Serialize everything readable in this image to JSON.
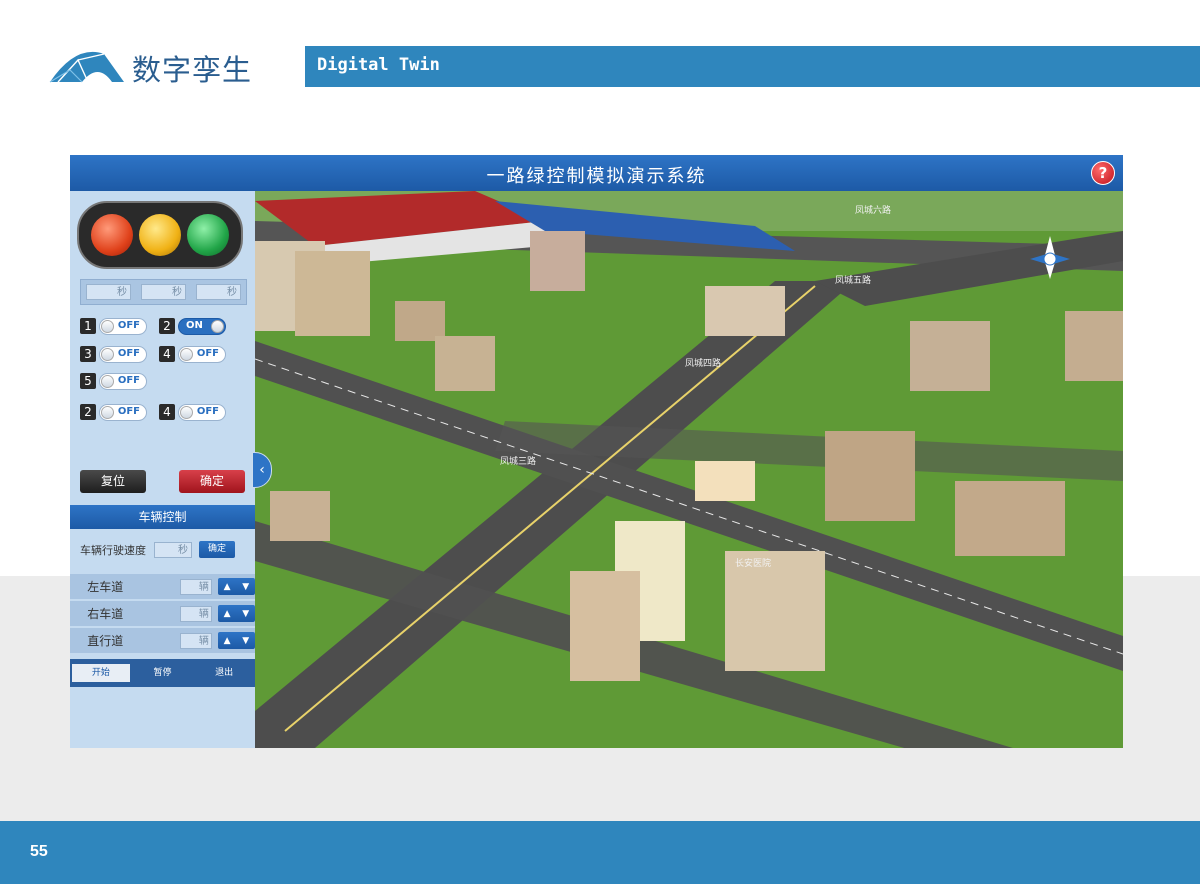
{
  "brand": {
    "logo_text": "数字孪生"
  },
  "header": {
    "title": "Digital Twin"
  },
  "footer": {
    "page_number": "55"
  },
  "app": {
    "title": "一路绿控制模拟演示系统",
    "help_label": "?",
    "traffic_light": {
      "lamps": [
        "red-lamp",
        "yellow-lamp",
        "green-lamp"
      ]
    },
    "timers": [
      {
        "unit": "秒"
      },
      {
        "unit": "秒"
      },
      {
        "unit": "秒"
      }
    ],
    "switches": [
      {
        "num": "1",
        "state": "OFF"
      },
      {
        "num": "2",
        "state": "ON"
      },
      {
        "num": "3",
        "state": "OFF"
      },
      {
        "num": "4",
        "state": "OFF"
      },
      {
        "num": "5",
        "state": "OFF"
      },
      {
        "num": "2",
        "state": "OFF"
      },
      {
        "num": "4",
        "state": "OFF"
      }
    ],
    "reset_label": "复位",
    "confirm_label": "确定",
    "vehicle_section": "车辆控制",
    "speed_label": "车辆行驶速度",
    "speed_unit": "秒",
    "speed_confirm": "确定",
    "lanes": [
      {
        "label": "左车道",
        "unit": "辆"
      },
      {
        "label": "右车道",
        "unit": "辆"
      },
      {
        "label": "直行道",
        "unit": "辆"
      }
    ],
    "tabs": [
      "开始",
      "暂停",
      "退出"
    ],
    "streets": [
      "凤城三路",
      "凤城四路",
      "凤城五路",
      "凤城六路"
    ],
    "hospital_sign": "长安医院"
  }
}
